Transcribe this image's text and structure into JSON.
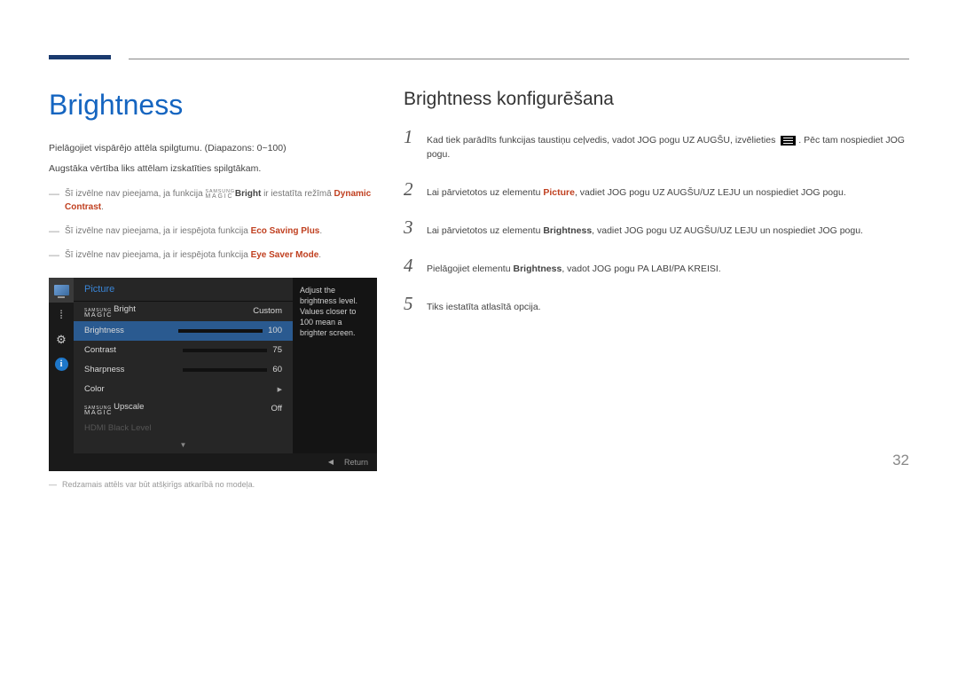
{
  "page": {
    "title": "Brightness",
    "intro1": "Pielāgojiet vispārējo attēla spilgtumu. (Diapazons: 0~100)",
    "intro2": "Augstāka vērtība liks attēlam izskatīties spilgtākam.",
    "note1_pre": "Šī izvēlne nav pieejama, ja funkcija ",
    "note1_mid": "Bright",
    "note1_post": " ir iestatīta režīmā ",
    "note1_hl": "Dynamic Contrast",
    "note2_pre": "Šī izvēlne nav pieejama, ja ir iespējota funkcija ",
    "note2_hl": "Eco Saving Plus",
    "note3_pre": "Šī izvēlne nav pieejama, ja ir iespējota funkcija ",
    "note3_hl": "Eye Saver Mode",
    "footnote": "Redzamais attēls var būt atšķirīgs atkarībā no modeļa.",
    "pagenum": "32"
  },
  "magic": {
    "top": "SAMSUNG",
    "bot": "MAGIC"
  },
  "osd": {
    "title": "Picture",
    "desc": "Adjust the brightness level. Values closer to 100 mean a brighter screen.",
    "items": {
      "magicbright": {
        "suffix": "Bright",
        "value": "Custom"
      },
      "brightness": {
        "label": "Brightness",
        "value": "100"
      },
      "contrast": {
        "label": "Contrast",
        "value": "75"
      },
      "sharpness": {
        "label": "Sharpness",
        "value": "60"
      },
      "color": {
        "label": "Color"
      },
      "upscale": {
        "suffix": "Upscale",
        "value": "Off"
      },
      "hdmi": {
        "label": "HDMI Black Level"
      }
    },
    "return": "Return"
  },
  "right": {
    "title": "Brightness konfigurēšana",
    "steps": {
      "s1a": "Kad tiek parādīts funkcijas taustiņu ceļvedis, vadot JOG pogu UZ AUGŠU, izvēlieties ",
      "s1b": ". Pēc tam nospiediet JOG pogu.",
      "s2a": "Lai pārvietotos uz elementu ",
      "s2_hl": "Picture",
      "s2b": ", vadiet JOG pogu UZ AUGŠU/UZ LEJU un nospiediet JOG pogu.",
      "s3a": "Lai pārvietotos uz elementu ",
      "s3_hl": "Brightness",
      "s3b": ", vadiet JOG pogu UZ AUGŠU/UZ LEJU un nospiediet JOG pogu.",
      "s4a": "Pielāgojiet elementu ",
      "s4_hl": "Brightness",
      "s4b": ", vadot JOG pogu PA LABI/PA KREISI.",
      "s5": "Tiks iestatīta atlasītā opcija."
    }
  }
}
